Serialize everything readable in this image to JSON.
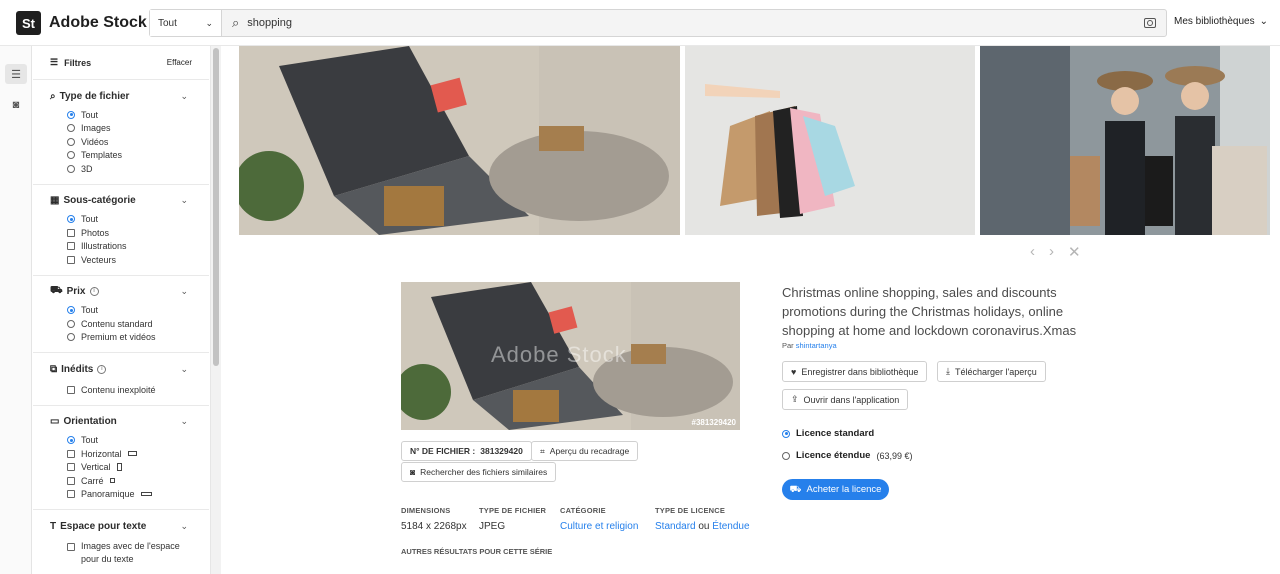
{
  "header": {
    "logo_mark": "St",
    "brand": "Adobe Stock",
    "scope": "Tout",
    "search_value": "shopping",
    "my_libraries": "Mes bibliothèques"
  },
  "filters": {
    "title": "Filtres",
    "clear": "Effacer",
    "file_type": {
      "label": "Type de fichier",
      "options": [
        "Tout",
        "Images",
        "Vidéos",
        "Templates",
        "3D"
      ]
    },
    "subcategory": {
      "label": "Sous-catégorie",
      "options": [
        "Tout",
        "Photos",
        "Illustrations",
        "Vecteurs"
      ]
    },
    "price": {
      "label": "Prix",
      "options": [
        "Tout",
        "Contenu standard",
        "Premium et vidéos"
      ]
    },
    "unseen": {
      "label": "Inédits",
      "options": [
        "Contenu inexploité"
      ]
    },
    "orientation": {
      "label": "Orientation",
      "options": [
        "Tout",
        "Horizontal",
        "Vertical",
        "Carré",
        "Panoramique"
      ]
    },
    "copy_space": {
      "label": "Espace pour texte",
      "options": [
        "Images avec de l'espace pour du texte"
      ]
    }
  },
  "detail": {
    "watermark": "Adobe Stock",
    "file_badge": "#381329420",
    "file_no_label": "N° DE FICHIER :",
    "file_no": "381329420",
    "crop_preview": "Aperçu du recadrage",
    "find_similar": "Rechercher des fichiers similaires",
    "title": "Christmas online shopping, sales and discounts promotions during the Christmas holidays, online shopping at home and lockdown coronavirus.Xmas",
    "by": "Par",
    "author": "shintartanya",
    "save_library": "Enregistrer dans bibliothèque",
    "download_preview": "Télécharger l'aperçu",
    "open_in_app": "Ouvrir dans l'application",
    "license_standard": "Licence standard",
    "license_extended": "Licence étendue",
    "license_extended_price": "(63,99 €)",
    "buy_license": "Acheter la licence",
    "meta": {
      "dimensions_label": "DIMENSIONS",
      "dimensions": "5184 x 2268px",
      "file_type_label": "TYPE DE FICHIER",
      "file_type": "JPEG",
      "category_label": "CATÉGORIE",
      "category": "Culture et religion",
      "license_type_label": "TYPE DE LICENCE",
      "license_standard": "Standard",
      "license_or": "ou",
      "license_extended": "Étendue"
    },
    "series": "AUTRES RÉSULTATS POUR CETTE SÉRIE"
  },
  "colors": {
    "accent": "#2680eb",
    "brand_dark": "#1f1f1f"
  }
}
